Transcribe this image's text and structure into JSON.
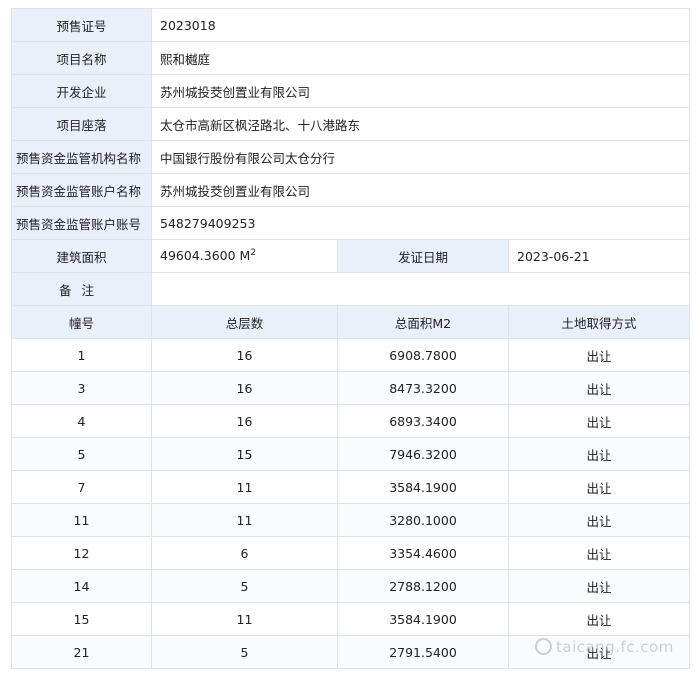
{
  "fields": {
    "presale_cert_label": "预售证号",
    "presale_cert_value": "2023018",
    "project_name_label": "项目名称",
    "project_name_value": "熙和樾庭",
    "developer_label": "开发企业",
    "developer_value": "苏州城投茭创置业有限公司",
    "location_label": "项目座落",
    "location_value": "太仓市高新区枫泾路北、十八港路东",
    "supervision_org_label": "预售资金监管机构名称",
    "supervision_org_value": "中国银行股份有限公司太仓分行",
    "account_name_label": "预售资金监管账户名称",
    "account_name_value": "苏州城投茭创置业有限公司",
    "account_no_label": "预售资金监管账户账号",
    "account_no_value": "548279409253",
    "area_label": "建筑面积",
    "area_value": "49604.3600 M",
    "area_unit_sup": "2",
    "issue_date_label": "发证日期",
    "issue_date_value": "2023-06-21",
    "remarks_label": "备注",
    "remarks_value": ""
  },
  "buildings": {
    "headers": [
      "幢号",
      "总层数",
      "总面积M2",
      "土地取得方式"
    ],
    "rows": [
      {
        "no": "1",
        "floors": "16",
        "area": "6908.7800",
        "land": "出让"
      },
      {
        "no": "3",
        "floors": "16",
        "area": "8473.3200",
        "land": "出让"
      },
      {
        "no": "4",
        "floors": "16",
        "area": "6893.3400",
        "land": "出让"
      },
      {
        "no": "5",
        "floors": "15",
        "area": "7946.3200",
        "land": "出让"
      },
      {
        "no": "7",
        "floors": "11",
        "area": "3584.1900",
        "land": "出让"
      },
      {
        "no": "11",
        "floors": "11",
        "area": "3280.1000",
        "land": "出让"
      },
      {
        "no": "12",
        "floors": "6",
        "area": "3354.4600",
        "land": "出让"
      },
      {
        "no": "14",
        "floors": "5",
        "area": "2788.1200",
        "land": "出让"
      },
      {
        "no": "15",
        "floors": "11",
        "area": "3584.1900",
        "land": "出让"
      },
      {
        "no": "21",
        "floors": "5",
        "area": "2791.5400",
        "land": "出让"
      }
    ]
  },
  "watermark": "taicang.fc.com"
}
